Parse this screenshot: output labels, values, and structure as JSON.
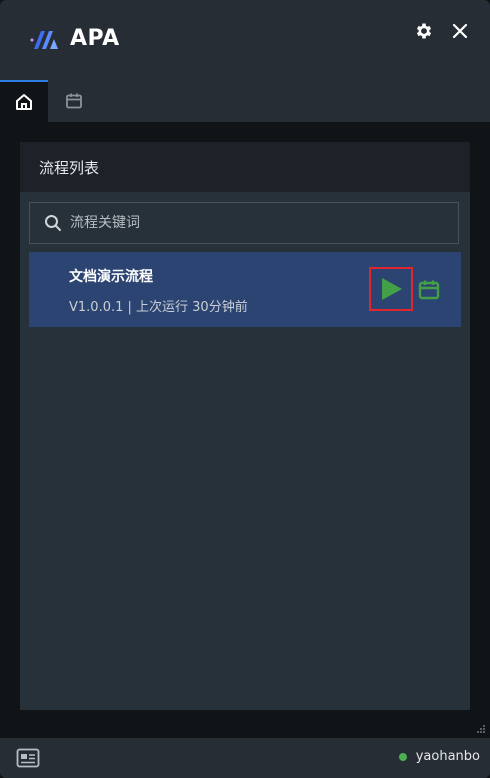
{
  "app": {
    "name": "APA"
  },
  "tabs": [
    {
      "id": "home",
      "icon": "home-icon",
      "active": true
    },
    {
      "id": "schedule",
      "icon": "calendar-icon",
      "active": false
    }
  ],
  "panel": {
    "title": "流程列表",
    "search": {
      "placeholder": "流程关键词",
      "value": ""
    },
    "items": [
      {
        "name": "文档演示流程",
        "meta": "V1.0.0.1 | 上次运行 30分钟前",
        "actions": [
          "play-icon",
          "calendar-icon"
        ]
      }
    ]
  },
  "footer": {
    "username": "yaohanbo",
    "status": "online"
  },
  "colors": {
    "accent": "#2f7de1",
    "selected_row": "#2b4472",
    "run_green": "#43a047",
    "highlight_red": "#e0262f",
    "status_green": "#4caf50"
  }
}
